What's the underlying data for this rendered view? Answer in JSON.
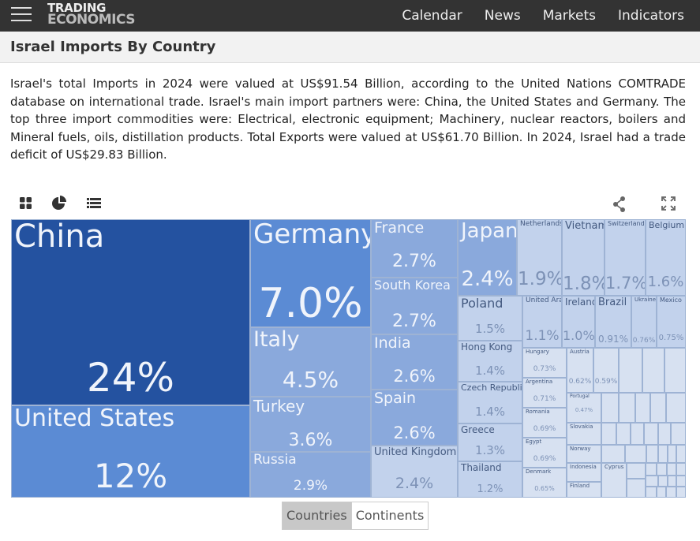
{
  "header": {
    "logo_line1": "TRADING",
    "logo_line2": "ECONOMICS",
    "nav": [
      "Calendar",
      "News",
      "Markets",
      "Indicators"
    ]
  },
  "page_title": "Israel Imports By Country",
  "description": "Israel's total Imports in 2024 were valued at US$91.54 Billion, according to the United Nations COMTRADE database on international trade. Israel's main import partners were: China, the United States and Germany. The top three import commodities were: Electrical, electronic equipment; Machinery, nuclear reactors, boilers and Mineral fuels, oils, distillation products. Total Exports were valued at US$61.70 Billion. In 2024, Israel had a trade deficit of US$29.83 Billion.",
  "toolbar": {
    "icons": [
      "grid-icon",
      "pie-chart-icon",
      "list-icon",
      "share-icon",
      "fullscreen-icon"
    ]
  },
  "treemap": {
    "countries": [
      {
        "name": "China",
        "value": "24%"
      },
      {
        "name": "United States",
        "value": "12%"
      },
      {
        "name": "Germany",
        "value": "7.0%"
      },
      {
        "name": "Italy",
        "value": "4.5%"
      },
      {
        "name": "Turkey",
        "value": "3.6%"
      },
      {
        "name": "Russia",
        "value": "2.9%"
      },
      {
        "name": "France",
        "value": "2.7%"
      },
      {
        "name": "South Korea",
        "value": "2.7%"
      },
      {
        "name": "India",
        "value": "2.6%"
      },
      {
        "name": "Spain",
        "value": "2.6%"
      },
      {
        "name": "United Kingdom",
        "value": "2.4%"
      },
      {
        "name": "Japan",
        "value": "2.4%"
      },
      {
        "name": "Netherlands",
        "value": "1.9%"
      },
      {
        "name": "Vietnam",
        "value": "1.8%"
      },
      {
        "name": "Switzerland",
        "value": "1.7%"
      },
      {
        "name": "Belgium",
        "value": "1.6%"
      },
      {
        "name": "Poland",
        "value": "1.5%"
      },
      {
        "name": "Hong Kong",
        "value": "1.4%"
      },
      {
        "name": "Czech Republic",
        "value": "1.4%"
      },
      {
        "name": "Greece",
        "value": "1.3%"
      },
      {
        "name": "Thailand",
        "value": "1.2%"
      },
      {
        "name": "United Arab...",
        "value": "1.1%"
      },
      {
        "name": "Ireland",
        "value": "1.0%"
      },
      {
        "name": "Brazil",
        "value": "0.91%"
      },
      {
        "name": "Ukraine",
        "value": "0.76%"
      },
      {
        "name": "Mexico",
        "value": "0.75%"
      },
      {
        "name": "Hungary",
        "value": "0.73%"
      },
      {
        "name": "Argentina",
        "value": "0.71%"
      },
      {
        "name": "Romania",
        "value": "0.69%"
      },
      {
        "name": "Egypt",
        "value": "0.69%"
      },
      {
        "name": "Denmark",
        "value": "0.65%"
      },
      {
        "name": "Austria",
        "value": "0.62%"
      },
      {
        "name": "",
        "value": "0.59%"
      },
      {
        "name": "Portugal",
        "value": "0.47%"
      },
      {
        "name": "Slovakia",
        "value": ""
      },
      {
        "name": "Norway",
        "value": ""
      },
      {
        "name": "Indonesia",
        "value": ""
      },
      {
        "name": "Finland",
        "value": ""
      },
      {
        "name": "Cyprus",
        "value": ""
      }
    ]
  },
  "tabs": [
    {
      "label": "Countries",
      "active": true
    },
    {
      "label": "Continents",
      "active": false
    }
  ],
  "colors": {
    "dark": "#2452a0",
    "mid": "#5b8bd4",
    "mid2": "#8aa9dc",
    "light": "#c2d2ec",
    "lighter": "#d7e1f1"
  }
}
